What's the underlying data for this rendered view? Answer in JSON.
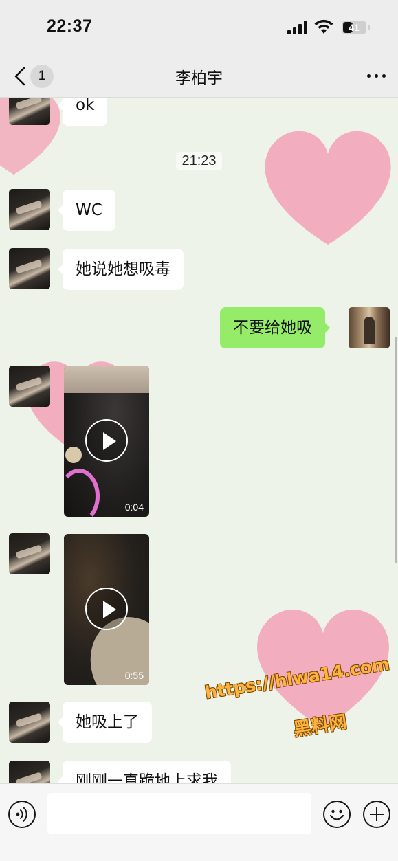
{
  "status_bar": {
    "time": "22:37",
    "battery_level": "41",
    "icons": [
      "signal-icon",
      "wifi-icon",
      "battery-icon"
    ]
  },
  "nav": {
    "title": "李柏宇",
    "unread_count": "1",
    "icons": [
      "chevron-left-icon",
      "more-icon"
    ]
  },
  "messages": [
    {
      "sender": "contact",
      "type": "text",
      "text": "ok"
    },
    {
      "type": "timestamp",
      "text": "21:23"
    },
    {
      "sender": "contact",
      "type": "text",
      "text": "WC"
    },
    {
      "sender": "contact",
      "type": "text",
      "text": "她说她想吸毒"
    },
    {
      "sender": "me",
      "type": "text",
      "text": "不要给她吸"
    },
    {
      "sender": "contact",
      "type": "video",
      "duration": "0:04"
    },
    {
      "sender": "contact",
      "type": "video",
      "duration": "0:55"
    },
    {
      "sender": "contact",
      "type": "text",
      "text": "她吸上了"
    },
    {
      "sender": "contact",
      "type": "text",
      "text": "刚刚一直跪地上求我"
    }
  ],
  "watermark": {
    "url": "https://hlwa14.com",
    "name": "黑料网"
  },
  "input_bar": {
    "placeholder": "",
    "icons": [
      "voice-icon",
      "emoji-icon",
      "plus-icon"
    ]
  },
  "colors": {
    "my_bubble": "#95ec69",
    "their_bubble": "#ffffff",
    "heart": "#f0a0b4",
    "watermark": "#ffb23d"
  }
}
